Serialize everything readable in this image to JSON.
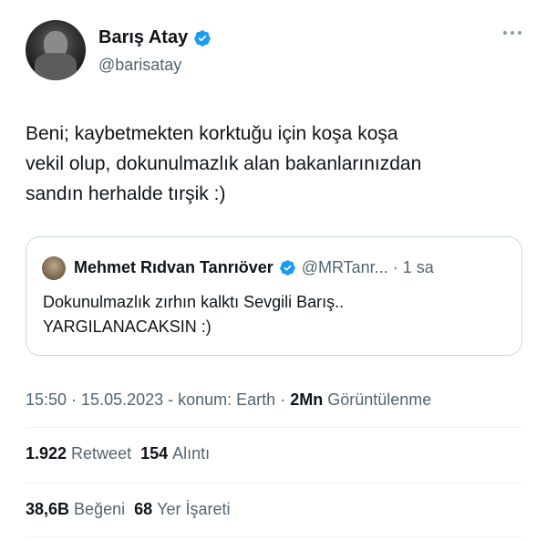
{
  "author": {
    "display_name": "Barış Atay",
    "handle": "@barisatay",
    "verified": true
  },
  "tweet": {
    "lines": [
      "Beni; kaybetmekten korktuğu için koşa koşa",
      "vekil olup, dokunulmazlık alan bakanlarınızdan",
      "sandın herhalde tırşik :)"
    ]
  },
  "quote": {
    "display_name": "Mehmet Rıdvan Tanrıöver",
    "handle": "@MRTanr...",
    "separator": "·",
    "time": "1 sa",
    "verified": true,
    "lines": [
      "Dokunulmazlık zırhın kalktı Sevgili Barış..",
      "YARGILANACAKSIN :)"
    ]
  },
  "meta": {
    "time": "15:50",
    "sep1": "·",
    "date": "15.05.2023",
    "location": "- konum: Earth",
    "sep2": "·",
    "views_count": "2Mn",
    "views_label": "Görüntülenme"
  },
  "stats": {
    "retweets_count": "1.922",
    "retweets_label": "Retweet",
    "quotes_count": "154",
    "quotes_label": "Alıntı",
    "likes_count": "38,6B",
    "likes_label": "Beğeni",
    "bookmarks_count": "68",
    "bookmarks_label": "Yer İşareti"
  },
  "colors": {
    "verified_blue": "#1d9bf0",
    "secondary_text": "#536471",
    "primary_text": "#0f1419",
    "border": "#cfd9de"
  },
  "icons": {
    "verified": "verified-badge-icon",
    "more": "more-horizontal-icon"
  }
}
